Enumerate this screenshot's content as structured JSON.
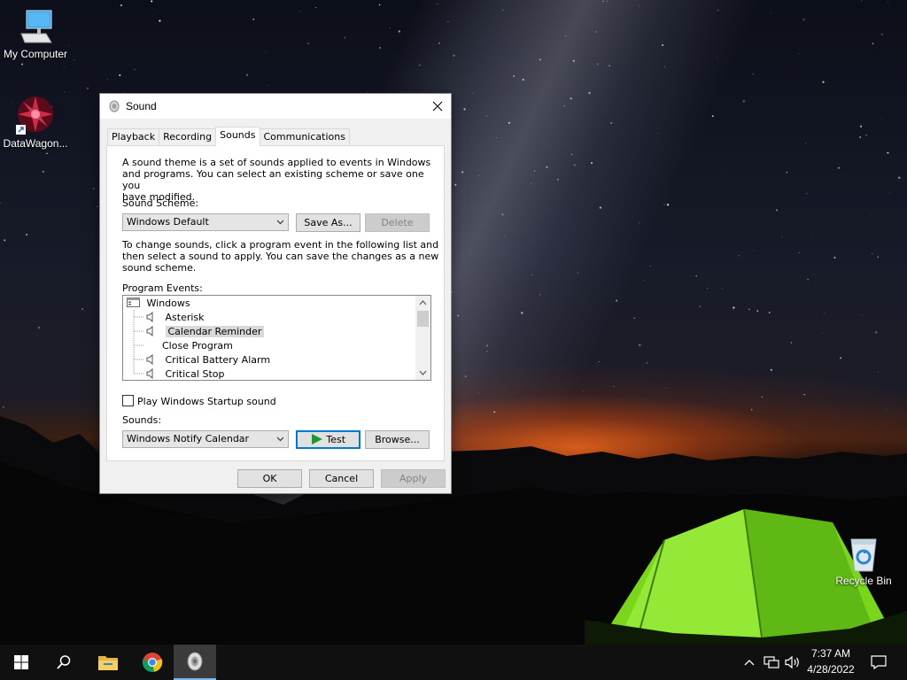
{
  "desktop": {
    "icons": [
      {
        "label": "My Computer",
        "icon": "computer-icon"
      },
      {
        "label": "DataWagon...",
        "icon": "datawagon-shortcut-icon"
      },
      {
        "label": "Recycle Bin",
        "icon": "recycle-bin-icon"
      }
    ]
  },
  "dialog": {
    "title": "Sound",
    "tabs": [
      "Playback",
      "Recording",
      "Sounds",
      "Communications"
    ],
    "active_tab": "Sounds",
    "intro_text": [
      "A sound theme is a set of sounds applied to events in Windows",
      "and programs.  You can select an existing scheme or save one you",
      "have modified."
    ],
    "scheme_label": "Sound Scheme:",
    "scheme_value": "Windows Default",
    "save_as_label": "Save As...",
    "delete_label": "Delete",
    "change_text": [
      "To change sounds, click a program event in the following list and",
      "then select a sound to apply.  You can save the changes as a new",
      "sound scheme."
    ],
    "program_events_label": "Program Events:",
    "events": [
      {
        "label": "Windows",
        "type": "group"
      },
      {
        "label": "Asterisk",
        "has_sound": true
      },
      {
        "label": "Calendar Reminder",
        "has_sound": true,
        "selected": true
      },
      {
        "label": "Close Program",
        "has_sound": false
      },
      {
        "label": "Critical Battery Alarm",
        "has_sound": true
      },
      {
        "label": "Critical Stop",
        "has_sound": true
      }
    ],
    "startup_label": "Play Windows Startup sound",
    "startup_checked": false,
    "sounds_label": "Sounds:",
    "sounds_value": "Windows Notify Calendar",
    "test_label": "Test",
    "browse_label": "Browse...",
    "ok_label": "OK",
    "cancel_label": "Cancel",
    "apply_label": "Apply"
  },
  "taskbar": {
    "time": "7:37 AM",
    "date": "4/28/2022",
    "colors": {
      "background": "#101010",
      "active_indicator": "#76b9ed",
      "accent": "#0078d7"
    }
  }
}
